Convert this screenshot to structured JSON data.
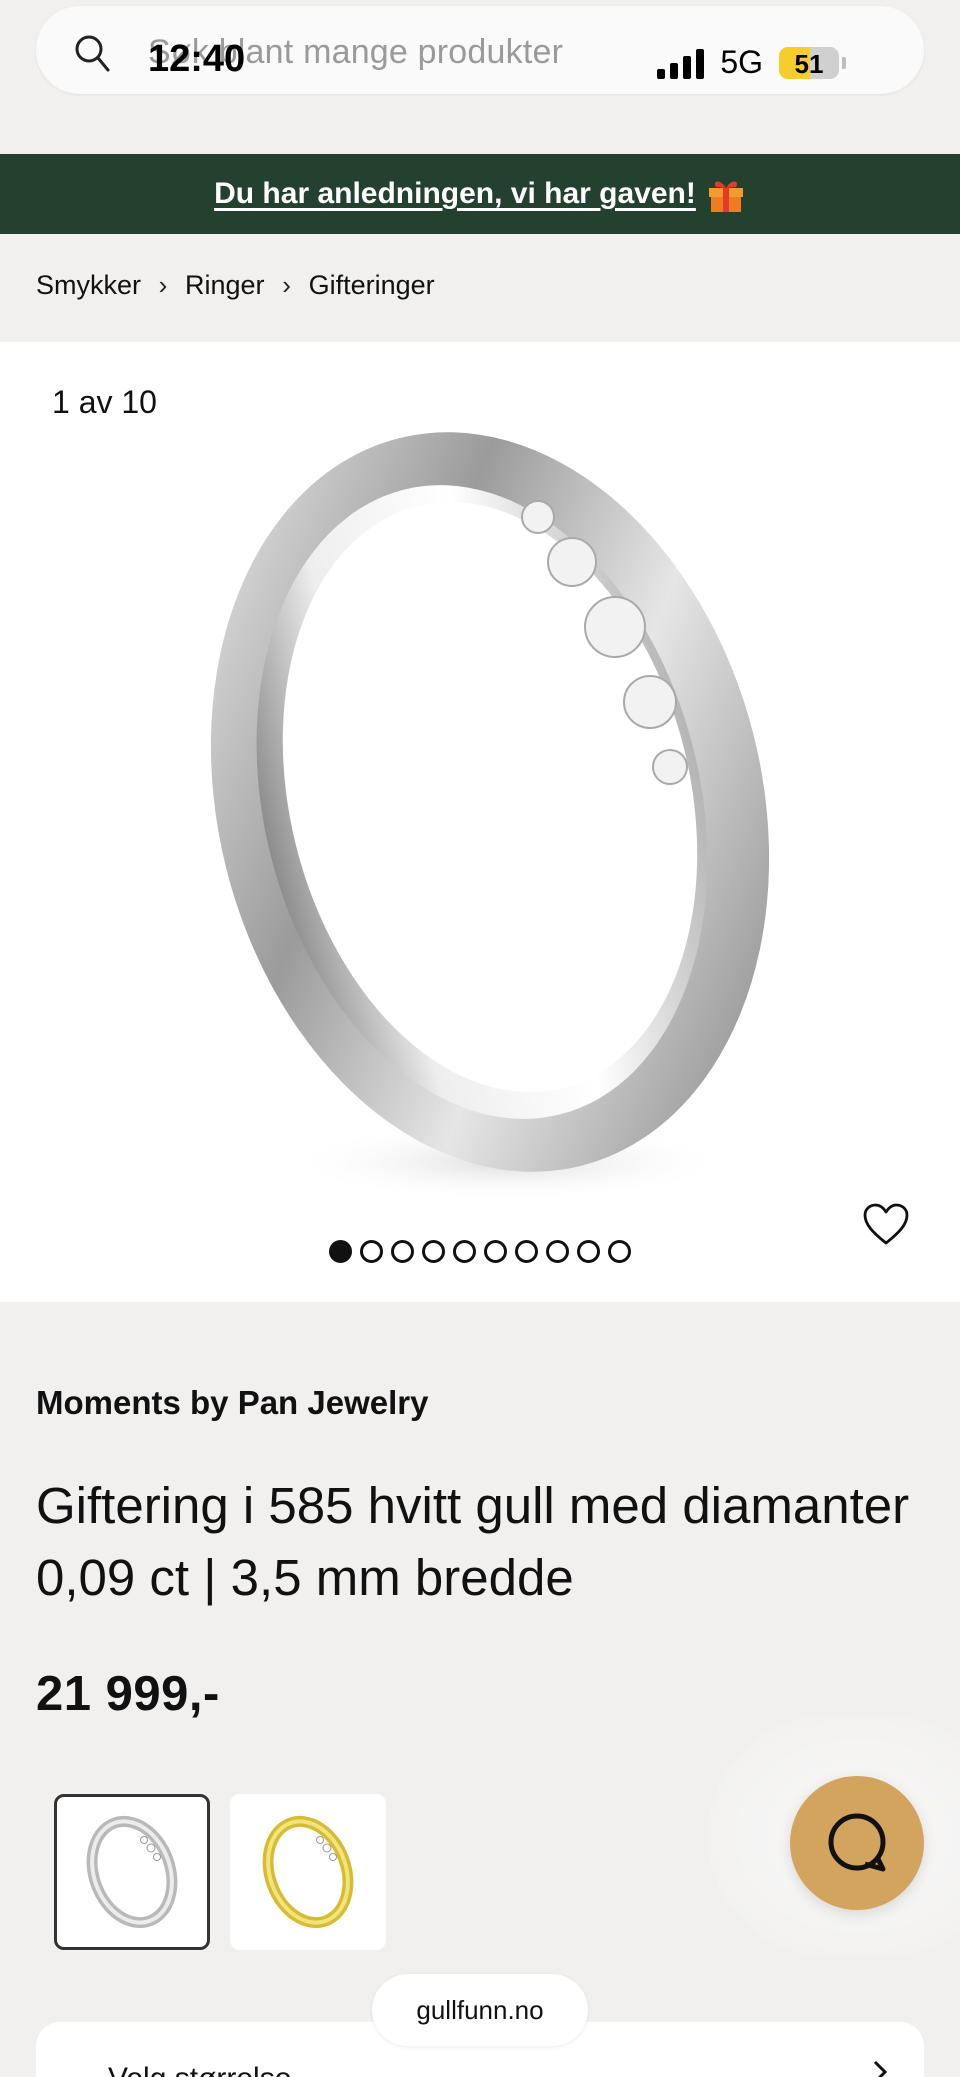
{
  "search": {
    "placeholder": "Søk blant mange produkter"
  },
  "status_bar": {
    "time": "12:40",
    "network": "5G",
    "battery": "51"
  },
  "promo": {
    "text": "Du har anledningen, vi har gaven!"
  },
  "breadcrumb": [
    "Smykker",
    "Ringer",
    "Gifteringer"
  ],
  "gallery": {
    "counter": "1 av 10",
    "total_images": 10,
    "current_index": 1
  },
  "product": {
    "brand": "Moments by Pan Jewelry",
    "title": "Giftering i 585 hvitt gull med diamanter 0,09 ct | 3,5 mm bredde",
    "price": "21 999,-"
  },
  "variants": [
    {
      "name": "white-gold",
      "selected": true,
      "color": "#c8c8c8"
    },
    {
      "name": "yellow-gold",
      "selected": false,
      "color": "#e2c94a"
    }
  ],
  "colors": {
    "promo_bg": "#24402f",
    "chat_button": "#d2a45e",
    "battery": "#f7cd2b"
  },
  "browser": {
    "url": "gullfunn.no"
  },
  "bottom_card": {
    "text": "Velg størrelse"
  }
}
